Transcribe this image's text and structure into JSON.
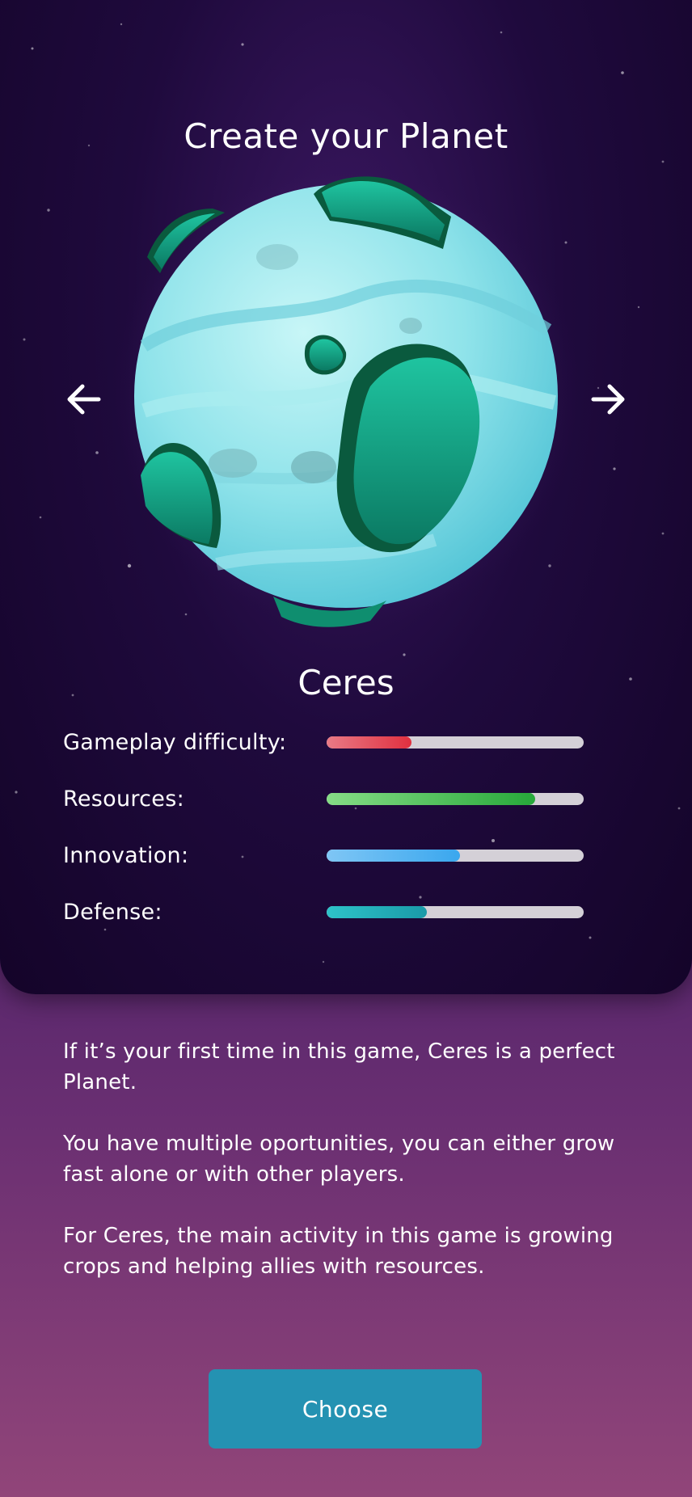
{
  "header": {
    "title": "Create your Planet"
  },
  "carousel": {
    "prev_icon": "arrow-left-icon",
    "next_icon": "arrow-right-icon"
  },
  "planet": {
    "name": "Ceres",
    "stats": [
      {
        "label": "Gameplay difficulty:",
        "value": 0.33,
        "color_start": "#e97a86",
        "color_end": "#e0303f"
      },
      {
        "label": "Resources:",
        "value": 0.81,
        "color_start": "#86dd86",
        "color_end": "#27a83a"
      },
      {
        "label": "Innovation:",
        "value": 0.52,
        "color_start": "#7fc6f5",
        "color_end": "#3aa7ee"
      },
      {
        "label": "Defense:",
        "value": 0.39,
        "color_start": "#2ec3c9",
        "color_end": "#1a9aa8"
      }
    ]
  },
  "description": [
    "If it’s your first time in this game, Ceres is a perfect Planet.",
    "You have multiple oportunities, you can either grow fast alone or with other players.",
    "For Ceres, the main activity in this game is growing crops and helping allies with resources."
  ],
  "actions": {
    "choose_label": "Choose"
  },
  "colors": {
    "button": "#2492b2",
    "card_background": "#1a0636",
    "page_gradient_top": "#2a0f4d",
    "page_gradient_bottom": "#914579"
  }
}
